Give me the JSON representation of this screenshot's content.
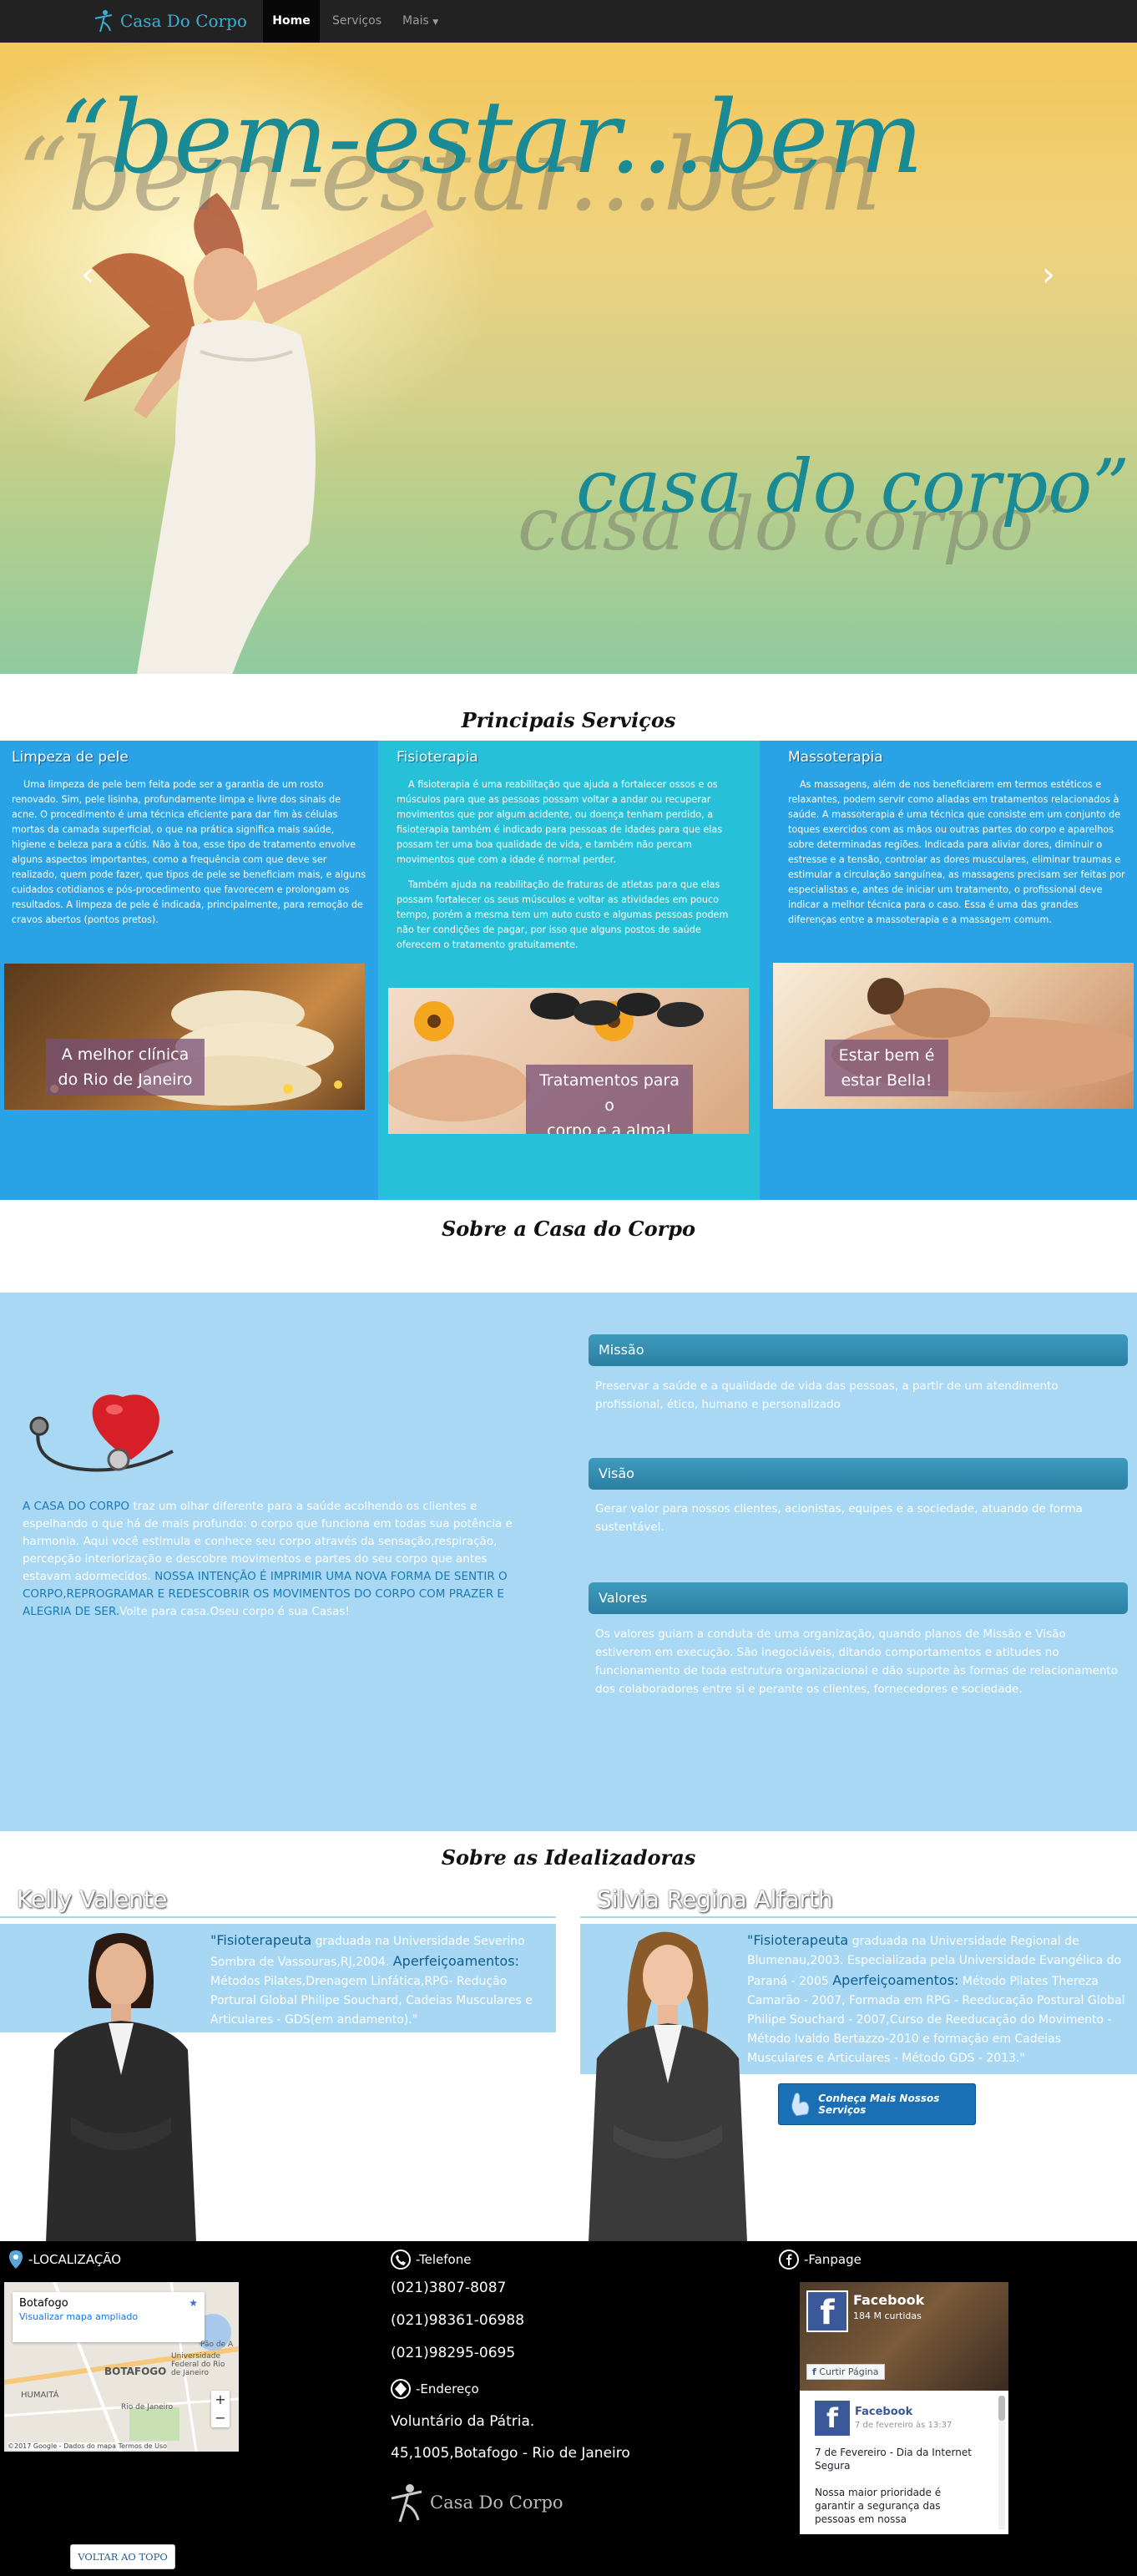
{
  "nav": {
    "brand": "Casa Do Corpo",
    "items": [
      {
        "label": "Home",
        "active": true
      },
      {
        "label": "Serviços"
      },
      {
        "label": "Mais"
      }
    ]
  },
  "hero": {
    "quote_top": "“bem-estar...bem",
    "quote_bottom": "casa do corpo”"
  },
  "services": {
    "title": "Principais Serviços",
    "items": [
      {
        "title": "Limpeza de pele",
        "paragraphs": [
          "Uma limpeza de pele bem feita pode ser a garantia de um rosto renovado. Sim, pele lisinha, profundamente limpa e livre dos sinais de acne. O procedimento é uma técnica eficiente para dar fim às células mortas da camada superficial, o que na prática significa mais saúde, higiene e beleza para a cútis. Não à toa, esse tipo de tratamento envolve alguns aspectos importantes, como a frequência com que deve ser realizado, quem pode fazer, que tipos de pele se beneficiam mais, e alguns cuidados cotidianos e pós-procedimento que favorecem e prolongam os resultados. A limpeza de pele é indicada, principalmente, para remoção de cravos abertos (pontos pretos)."
        ],
        "caption": [
          "A melhor clínica",
          "do Rio de Janeiro"
        ]
      },
      {
        "title": "Fisioterapia",
        "paragraphs": [
          "A fisioterapia é uma reabilitação que ajuda a fortalecer ossos e os músculos para que as pessoas possam voltar a andar ou recuperar movimentos que por algum acidente, ou doença tenham perdido, a fisioterapia também é indicado para pessoas de idades para que elas possam ter uma boa qualidade de vida, e também não percam movimentos que com a idade é normal perder.",
          "Também ajuda na reabilitação de fraturas de atletas para que elas possam fortalecer os seus músculos e voltar as atividades em pouco tempo, porém a mesma tem um auto custo e algumas pessoas podem não ter condições de pagar, por isso que alguns postos de saúde oferecem o tratamento gratuitamente."
        ],
        "caption": [
          "Tratamentos para o",
          "corpo e a alma!"
        ]
      },
      {
        "title": "Massoterapia",
        "paragraphs": [
          "As massagens, além de nos beneficiarem em termos estéticos e relaxantes, podem servir como aliadas em tratamentos relacionados à saúde. A massoterapia é uma técnica que consiste em um conjunto de toques exercidos com as mãos ou outras partes do corpo e aparelhos sobre determinadas regiões. Indicada para aliviar dores, diminuir o estresse e a tensão, controlar as dores musculares, eliminar traumas e estimular a circulação sanguínea, as massagens precisam ser feitas por especialistas e, antes de iniciar um tratamento, o profissional deve indicar a melhor técnica para o caso. Essa é uma das grandes diferenças entre a massoterapia e a massagem comum."
        ],
        "caption": [
          "Estar bem é",
          "estar Bella!"
        ]
      }
    ]
  },
  "about": {
    "title": "Sobre a Casa do Corpo",
    "text_hl1": "A CASA DO CORPO",
    "text_1": " traz um olhar diferente para a saúde acolhendo os clientes e espelhando o que há de mais profundo: o corpo que funciona em todas sua potência e harmonia. Aqui você estimula e conhece seu corpo através da sensação,respiração, percepção interiorização e descobre movimentos e partes do seu corpo que antes estavam adormecidos. ",
    "text_hl2": "NOSSA INTENÇÃO É IMPRIMIR UMA NOVA FORMA DE SENTIR O CORPO,REPROGRAMAR E REDESCOBRIR OS MOVIMENTOS DO CORPO COM PRAZER E ALEGRIA DE SER.",
    "text_2": "Volte para casa.Oseu corpo é sua Casas!",
    "blocks": [
      {
        "title": "Missão",
        "text": "Preservar a saúde e a qualidade de vida das pessoas, a partir de um atendimento profissional, ético, humano e personalizado"
      },
      {
        "title": "Visão",
        "text": "Gerar valor para nossos clientes, acionistas, equipes e a sociedade, atuando de forma sustentável."
      },
      {
        "title": "Valores",
        "text": "Os valores guiam a conduta de uma organização, quando planos de Missão e Visão estiverem em execução. São inegociáveis, ditando comportamentos e atitudes no funcionamento de toda estrutura organizacional e dão suporte às formas de relacionamento dos colaboradores entre si e perante os clientes, fornecedores e sociedade."
      }
    ]
  },
  "founders": {
    "title": "Sobre as Idealizadoras",
    "people": [
      {
        "name": "Kelly Valente",
        "role": "\"Fisioterapeuta",
        "t1": " graduada na Universidade Severino Sombra de Vassouras,RJ,2004. ",
        "spec": "Aperfeiçoamentos:",
        "t2": " Métodos Pilates,Drenagem Linfática,RPG- Redução Portural Global Philipe Souchard, Cadeias Musculares e Articulares - GDS(em andamento).\""
      },
      {
        "name": "Silvia Regina Alfarth",
        "role": "\"Fisioterapeuta",
        "t1": " graduada na Universidade Regional de Blumenau,2003. Especializada pela Universidade Evangélica do Paraná - 2005 ",
        "spec": "Aperfeiçoamentos:",
        "t2": " Método Pilates Thereza Camarão - 2007, Formada em RPG - Reeducação Postural Global Philipe Souchard - 2007,Curso de Reeducação do Movimento - Método Ivaldo Bertazzo-2010 e formação em Cadeias Musculares e Articulares - Método GDS - 2013.\""
      }
    ],
    "cta": "Conheça Mais Nossos Serviços"
  },
  "footer": {
    "location_title": "-LOCALIZAÇÃO",
    "map": {
      "place": "Botafogo",
      "link": "Visualizar mapa ampliado",
      "labels": [
        "BOTAFOGO",
        "HUMAITÁ",
        "Rio de Janeiro",
        "Universidade Federal do Rio de Janeiro",
        "Pão de A"
      ],
      "attribution": "©2017 Google - Dados do mapa    Termos de Uso"
    },
    "phone_title": "-Telefone",
    "phones": [
      "(021)3807-8087",
      "(021)98361-06988",
      "(021)98295-0695"
    ],
    "address_title": "-Endereço",
    "address": [
      "Voluntário da Pátria.",
      "45,1005,Botafogo - Rio de Janeiro"
    ],
    "brand": "Casa Do Corpo",
    "fanpage_title": "-Fanpage",
    "fb": {
      "name": "Facebook",
      "likes": "184 M curtidas",
      "like_btn": "Curtir Página",
      "post_name": "Facebook",
      "post_date": "7 de fevereiro às 13:37",
      "post_text": "7 de Fevereiro - Dia da Internet Segura",
      "post_text2": "Nossa maior prioridade é garantir a segurança das pessoas em nossa"
    },
    "back_to_top": "VOLTAR AO TOPO"
  },
  "colors": {
    "nav_bg": "#222222",
    "accent_teal": "#1a8a94",
    "service_blue": "#2aa3e6",
    "service_cyan": "#27c0d9",
    "about_bg": "#a8d8f4",
    "bar_blue": "#2b7fa3"
  }
}
